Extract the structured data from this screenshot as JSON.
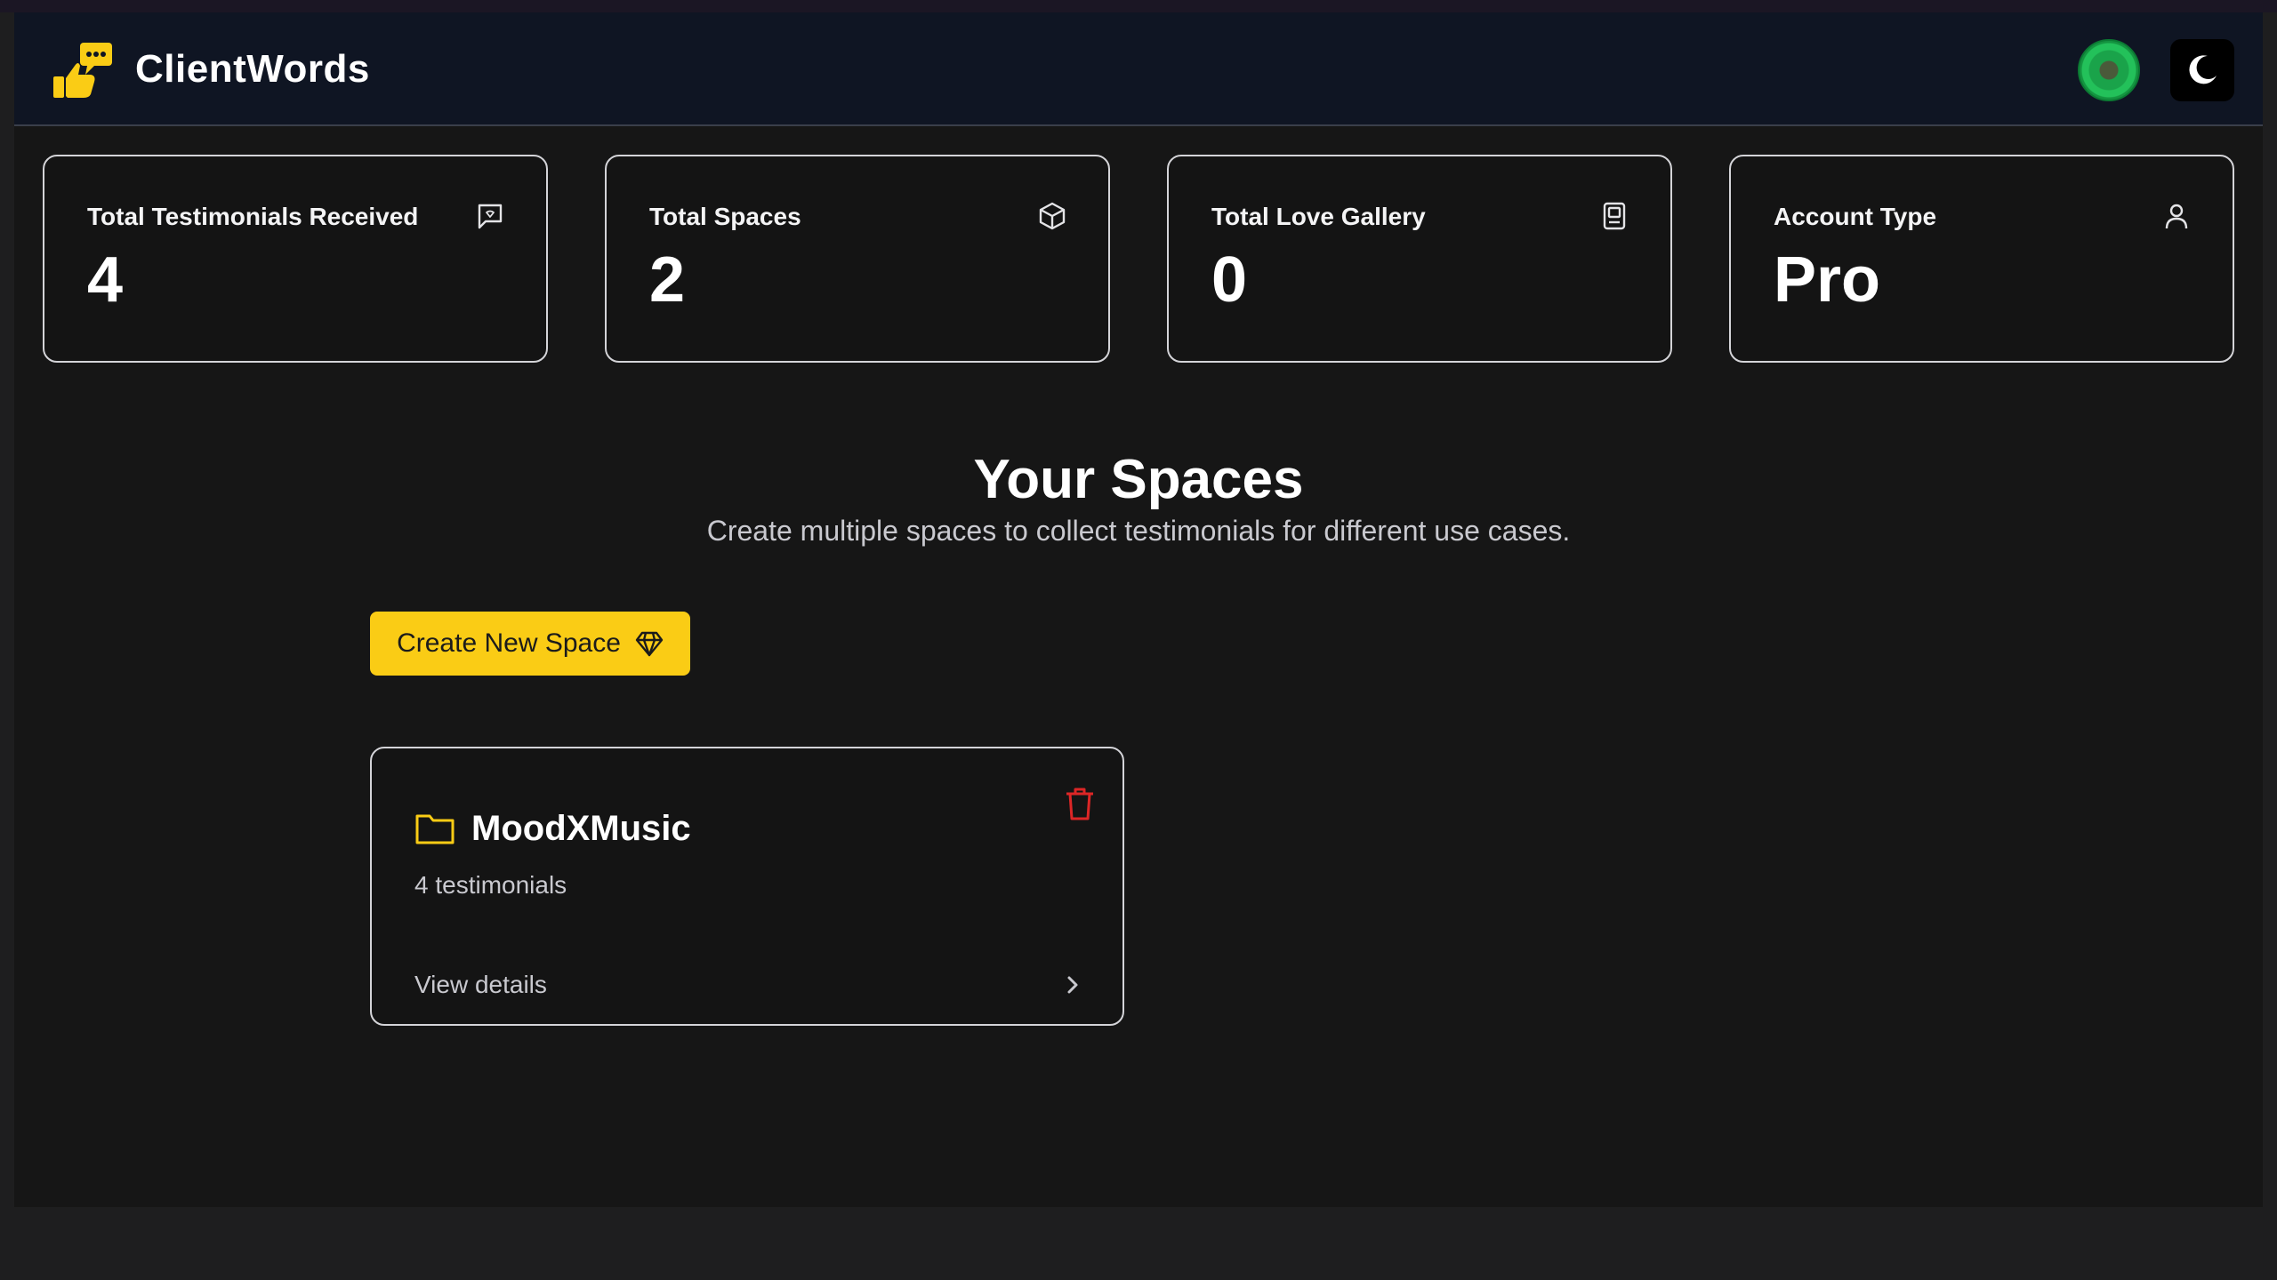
{
  "app": {
    "name": "ClientWords",
    "logo_icon": "thumbs-up-chat-icon",
    "accent_color": "#facc15"
  },
  "header": {
    "avatar_icon": "user-avatar",
    "theme_toggle_icon": "moon-icon"
  },
  "stats": [
    {
      "title": "Total Testimonials Received",
      "value": "4",
      "icon": "message-square-icon"
    },
    {
      "title": "Total Spaces",
      "value": "2",
      "icon": "box-icon"
    },
    {
      "title": "Total Love Gallery",
      "value": "0",
      "icon": "gallery-icon"
    },
    {
      "title": "Account Type",
      "value": "Pro",
      "icon": "user-icon"
    }
  ],
  "spaces_section": {
    "title": "Your Spaces",
    "subtitle": "Create multiple spaces to collect testimonials for different use cases.",
    "create_button_label": "Create New Space",
    "create_button_icon": "gem-icon"
  },
  "spaces": [
    {
      "name": "MoodXMusic",
      "count_label": "4 testimonials",
      "link_label": "View details",
      "icon": "folder-icon",
      "delete_icon": "trash-icon",
      "delete_color": "#dc2626"
    }
  ]
}
